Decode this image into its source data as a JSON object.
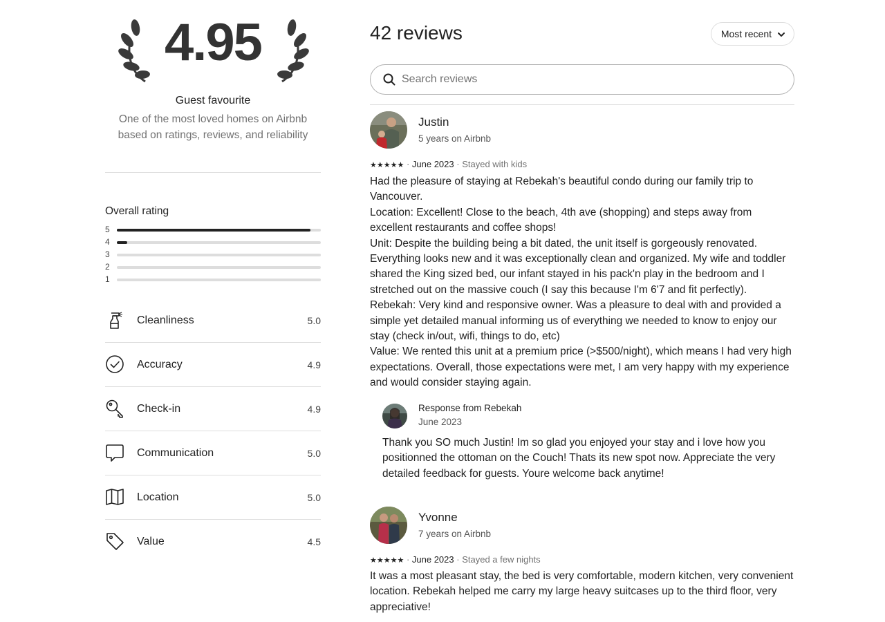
{
  "summary": {
    "overall_score": "4.95",
    "badge_title": "Guest favourite",
    "badge_desc_line1": "One of the most loved homes on Airbnb",
    "badge_desc_line2": "based on ratings, reviews, and reliability"
  },
  "overall_rating": {
    "title": "Overall rating",
    "bars": [
      {
        "label": "5",
        "fraction": 0.95
      },
      {
        "label": "4",
        "fraction": 0.05
      },
      {
        "label": "3",
        "fraction": 0
      },
      {
        "label": "2",
        "fraction": 0
      },
      {
        "label": "1",
        "fraction": 0
      }
    ]
  },
  "categories": [
    {
      "label": "Cleanliness",
      "score": "5.0",
      "icon": "spray-bottle-icon"
    },
    {
      "label": "Accuracy",
      "score": "4.9",
      "icon": "check-circle-icon"
    },
    {
      "label": "Check-in",
      "score": "4.9",
      "icon": "key-icon"
    },
    {
      "label": "Communication",
      "score": "5.0",
      "icon": "chat-bubble-icon"
    },
    {
      "label": "Location",
      "score": "5.0",
      "icon": "map-icon"
    },
    {
      "label": "Value",
      "score": "4.5",
      "icon": "tag-icon"
    }
  ],
  "reviews_header": {
    "count_label": "42 reviews",
    "sort_label": "Most recent",
    "search_placeholder": "Search reviews"
  },
  "reviews": [
    {
      "name": "Justin",
      "tenure": "5 years on Airbnb",
      "stars": "★★★★★",
      "date": "June 2023",
      "trip": "Stayed with kids",
      "body": [
        "Had the pleasure of staying at Rebekah's beautiful condo during our family trip to Vancouver.",
        "Location: Excellent! Close to the beach, 4th ave (shopping) and steps away from excellent restaurants and coffee shops!",
        "Unit: Despite the building being a bit dated, the unit itself is gorgeously renovated. Everything looks new and it was exceptionally clean and organized. My wife and toddler shared the King sized bed, our infant stayed in his pack'n play in the bedroom and I stretched out on the massive couch (I say this because I'm 6'7 and fit perfectly).",
        "Rebekah: Very kind and responsive owner. Was a pleasure to deal with and provided a simple yet detailed manual informing us of everything we needed to know to enjoy our stay (check in/out, wifi, things to do, etc)",
        "Value: We rented this unit at a premium price (>$500/night), which means I had very high expectations. Overall, those expectations were met, I am very happy with my experience and would consider staying again."
      ],
      "response": {
        "title": "Response from Rebekah",
        "date": "June 2023",
        "body": "Thank you SO much Justin! Im so glad you enjoyed your stay and i love how you positionned the ottoman on the Couch! Thats its new spot now. Appreciate the very detailed feedback for guests. Youre welcome back anytime!"
      }
    },
    {
      "name": "Yvonne",
      "tenure": "7 years on Airbnb",
      "stars": "★★★★★",
      "date": "June 2023",
      "trip": "Stayed a few nights",
      "body": [
        "It was a most pleasant stay, the bed is very comfortable, modern kitchen, very convenient location. Rebekah helped me carry my large heavy suitcases up to the third floor, very appreciative!"
      ]
    }
  ],
  "colors": {
    "text": "#222222",
    "muted": "#717171",
    "divider": "#dddddd",
    "bar_fill": "#222222",
    "bar_track": "#dddddd"
  }
}
